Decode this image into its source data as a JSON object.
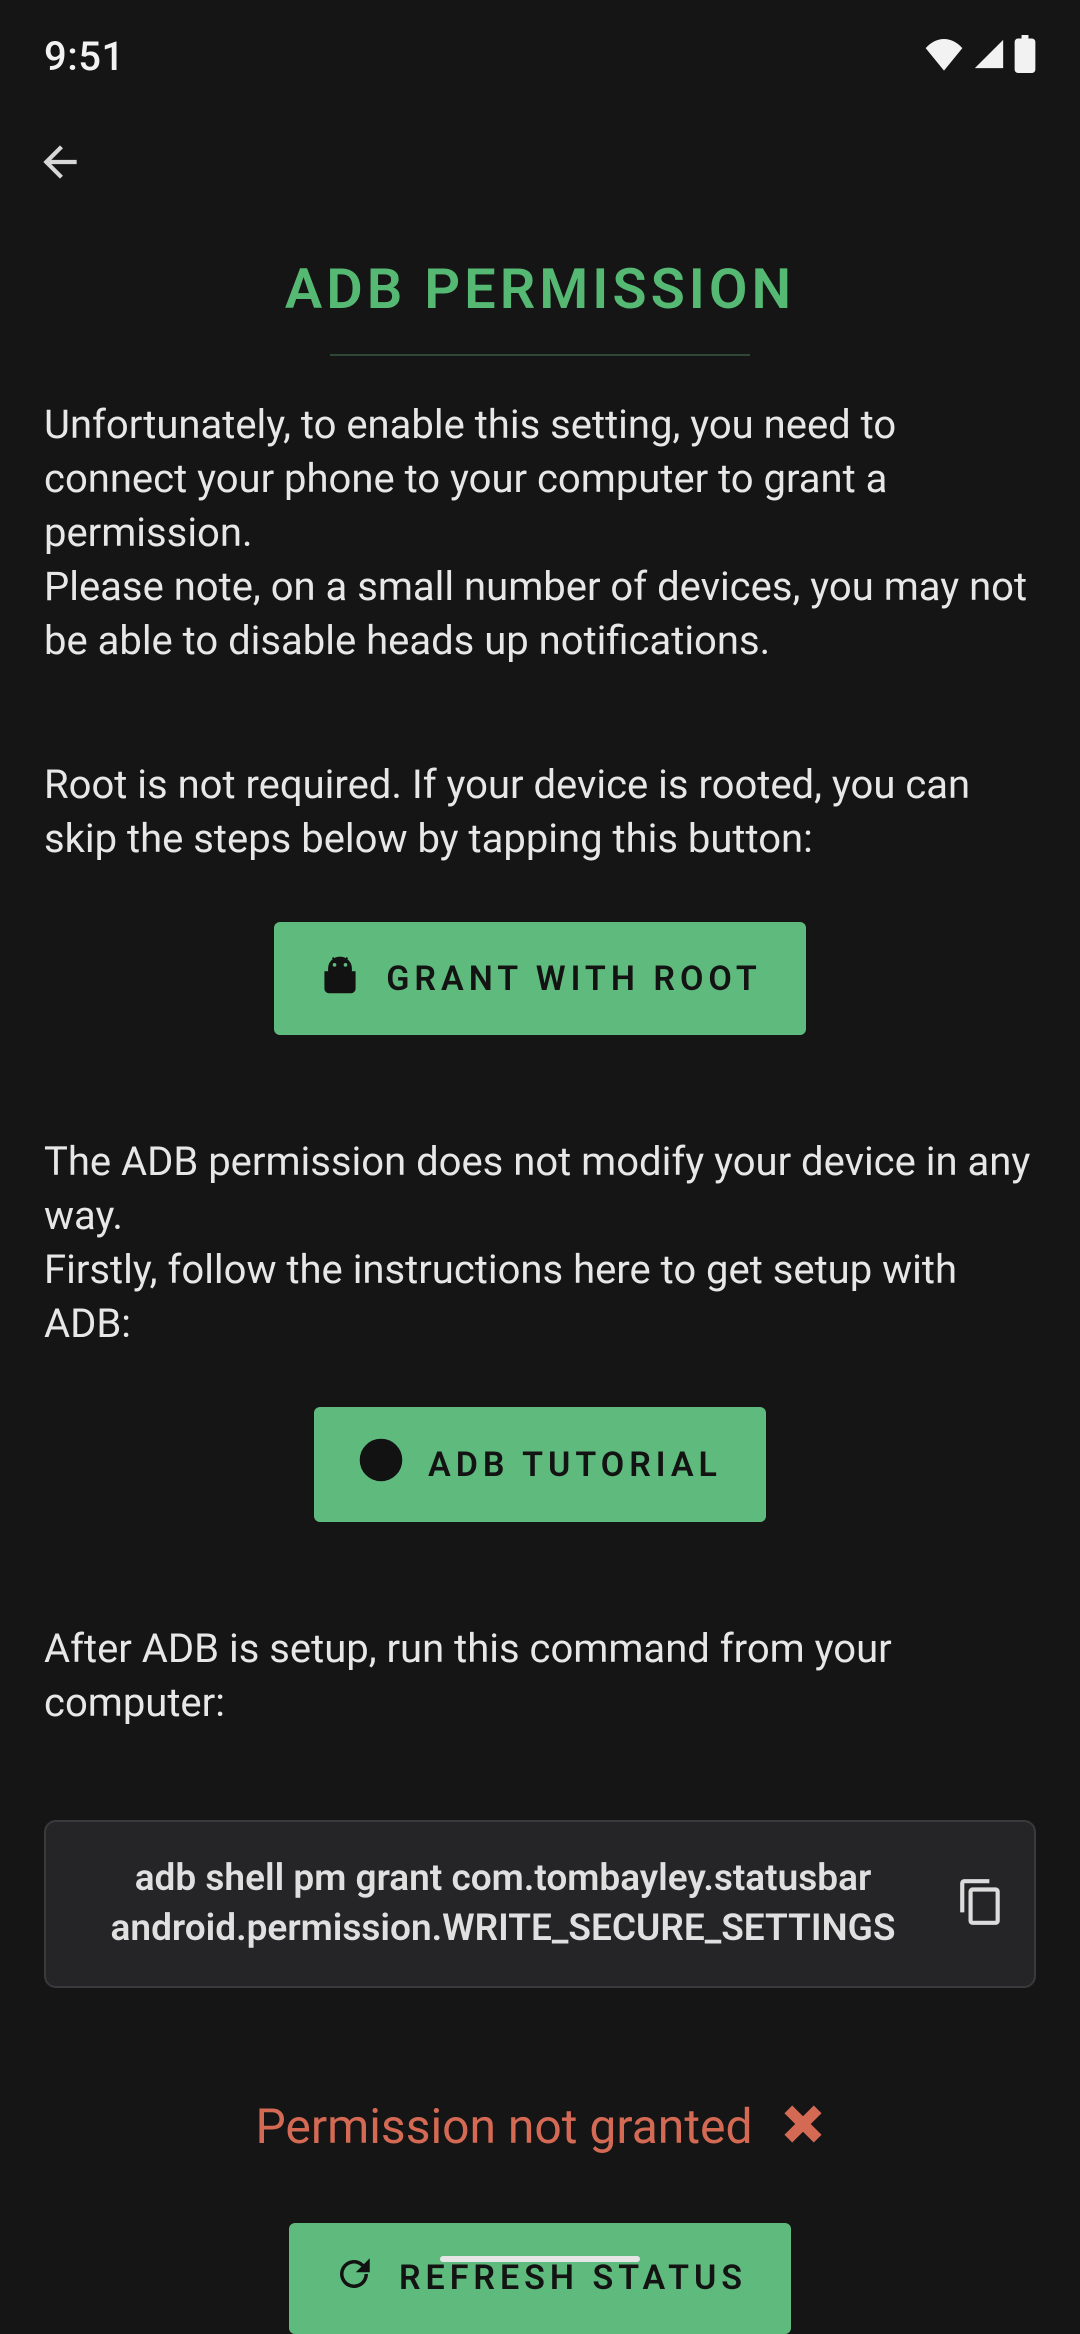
{
  "status_bar": {
    "time": "9:51"
  },
  "page": {
    "title": "ADB PERMISSION",
    "intro_p1": "Unfortunately, to enable this setting, you need to connect your phone to your computer to grant a permission.",
    "intro_p2": "Please note, on a small number of devices, you may not be able to disable heads up notifications.",
    "root_p": "Root is not required. If your device is rooted, you can skip the steps below by tapping this button:",
    "grant_root_label": "GRANT WITH ROOT",
    "adb_p1": "The ADB permission does not modify your device in any way.",
    "adb_p2": "Firstly, follow the instructions here to get setup with ADB:",
    "adb_tutorial_label": "ADB TUTORIAL",
    "after_p": "After ADB is setup, run this command from your computer:",
    "command": "adb shell pm grant com.tombayley.statusbar android.permission.WRITE_SECURE_SETTINGS",
    "perm_status": "Permission not granted",
    "refresh_label": "REFRESH STATUS"
  },
  "colors": {
    "accent": "#5fbb7d",
    "error": "#d46a54",
    "bg": "#151516"
  },
  "icons": {
    "back": "arrow-left-icon",
    "android": "android-icon",
    "info": "info-icon",
    "copy": "copy-icon",
    "close": "close-icon",
    "refresh": "refresh-icon",
    "wifi": "wifi-icon",
    "signal": "signal-icon",
    "battery": "battery-icon"
  }
}
